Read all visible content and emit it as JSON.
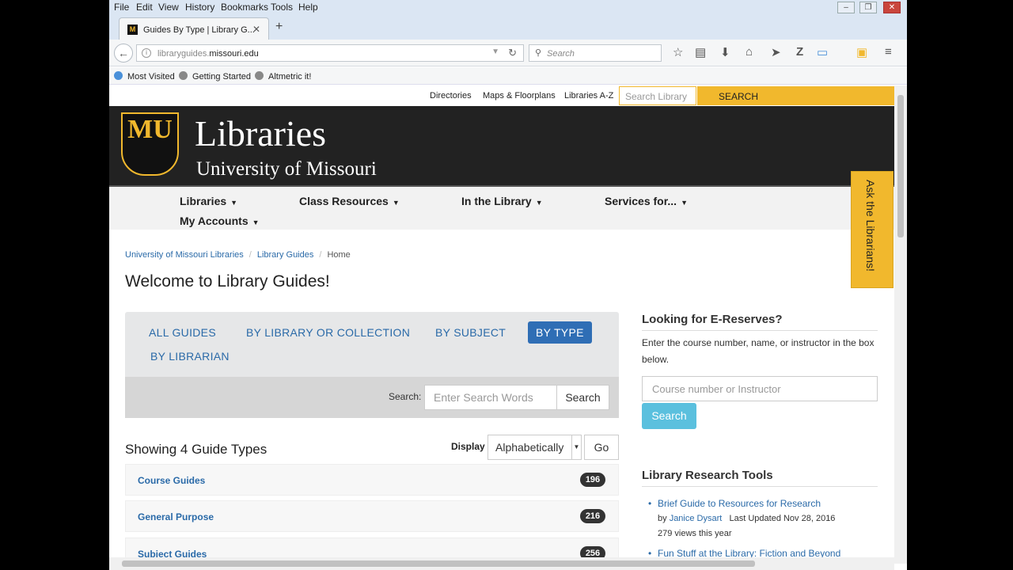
{
  "browser": {
    "menu": [
      "File",
      "Edit",
      "View",
      "History",
      "Bookmarks",
      "Tools",
      "Help"
    ],
    "tab_title": "Guides By Type | Library G...",
    "tab_close": "✕",
    "new_tab": "+",
    "url_host_prefix": "libraryguides.",
    "url_host_main": "missouri.edu",
    "search_placeholder": "Search",
    "bookmarks": [
      "Most Visited",
      "Getting Started",
      "Altmetric it!"
    ]
  },
  "utility": {
    "links": [
      "Directories",
      "Maps & Floorplans",
      "Libraries A-Z"
    ],
    "search_placeholder": "Search Library",
    "search_button": "SEARCH"
  },
  "banner": {
    "logo_text": "MU",
    "title": "Libraries",
    "subtitle": "University of Missouri"
  },
  "nav": [
    "Libraries",
    "Class Resources",
    "In the Library",
    "Services for...",
    "My Accounts"
  ],
  "ask": "Ask the Librarians!",
  "breadcrumb": {
    "items": [
      "University of Missouri Libraries",
      "Library Guides"
    ],
    "current": "Home"
  },
  "page_title": "Welcome to Library Guides!",
  "guide_tabs": [
    "ALL GUIDES",
    "BY LIBRARY OR COLLECTION",
    "BY SUBJECT",
    "BY TYPE",
    "BY LIBRARIAN"
  ],
  "search": {
    "label": "Search:",
    "placeholder": "Enter Search Words",
    "button": "Search"
  },
  "showing": "Showing 4 Guide Types",
  "display": {
    "label": "Display",
    "selected": "Alphabetically",
    "go": "Go"
  },
  "guide_types": [
    {
      "name": "Course Guides",
      "count": "196"
    },
    {
      "name": "General Purpose",
      "count": "216"
    },
    {
      "name": "Subject Guides",
      "count": "256"
    }
  ],
  "eres": {
    "title": "Looking for E-Reserves?",
    "text": "Enter the course number, name, or instructor in the box below.",
    "placeholder": "Course number or Instructor",
    "button": "Search"
  },
  "tools": {
    "title": "Library Research Tools",
    "items": [
      {
        "title": "Brief Guide to Resources for Research",
        "by": "by",
        "author": "Janice Dysart",
        "updated": "Last Updated Nov 28, 2016",
        "views": "279 views this year"
      },
      {
        "title": "Fun Stuff at the Library: Fiction and Beyond"
      }
    ]
  },
  "colors": {
    "gold": "#f1b82d",
    "link": "#2a6aa8",
    "active": "#2f6eb5"
  }
}
